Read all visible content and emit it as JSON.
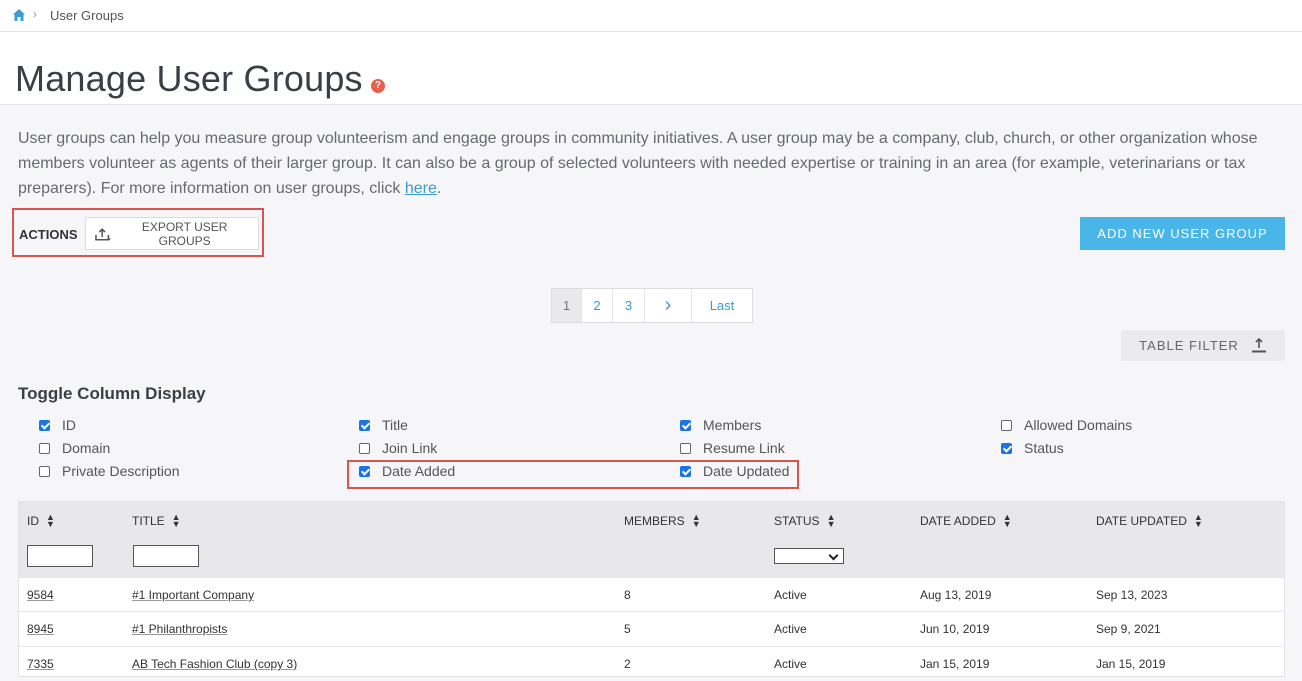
{
  "breadcrumb": {
    "icon": "home-icon",
    "current": "User Groups"
  },
  "page": {
    "title": "Manage User Groups",
    "help_icon": "?"
  },
  "intro": {
    "text": "User groups can help you measure group volunteerism and engage groups in community initiatives. A user group may be a company, club, church, or other organization whose members volunteer as agents of their larger group. It can also be a group of selected volunteers with needed expertise or training in an area (for example, veterinarians or tax preparers). For more information on user groups, click ",
    "link_text": "here",
    "tail": "."
  },
  "actions": {
    "label": "ACTIONS",
    "export_label": "EXPORT USER GROUPS",
    "add_label": "ADD NEW USER GROUP"
  },
  "pagination": {
    "pages": [
      "1",
      "2",
      "3"
    ],
    "next": "›",
    "last": "Last",
    "active": "1"
  },
  "table_filter": {
    "label": "TABLE FILTER"
  },
  "toggle": {
    "title": "Toggle Column Display",
    "options": [
      {
        "label": "ID",
        "checked": true
      },
      {
        "label": "Domain",
        "checked": false
      },
      {
        "label": "Private Description",
        "checked": false
      },
      {
        "label": "Title",
        "checked": true
      },
      {
        "label": "Join Link",
        "checked": false
      },
      {
        "label": "Date Added",
        "checked": true
      },
      {
        "label": "Members",
        "checked": true
      },
      {
        "label": "Resume Link",
        "checked": false
      },
      {
        "label": "Date Updated",
        "checked": true
      },
      {
        "label": "Allowed Domains",
        "checked": false
      },
      {
        "label": "Status",
        "checked": true
      }
    ]
  },
  "table": {
    "columns": [
      "ID",
      "TITLE",
      "MEMBERS",
      "STATUS",
      "DATE ADDED",
      "DATE UPDATED"
    ],
    "rows": [
      {
        "id": "9584",
        "title": "#1 Important Company",
        "members": "8",
        "status": "Active",
        "date_added": "Aug 13, 2019",
        "date_updated": "Sep 13, 2023"
      },
      {
        "id": "8945",
        "title": "#1 Philanthropists",
        "members": "5",
        "status": "Active",
        "date_added": "Jun 10, 2019",
        "date_updated": "Sep 9, 2021"
      },
      {
        "id": "7335",
        "title": "AB Tech Fashion Club (copy 3)",
        "members": "2",
        "status": "Active",
        "date_added": "Jan 15, 2019",
        "date_updated": "Jan 15, 2019"
      }
    ]
  }
}
